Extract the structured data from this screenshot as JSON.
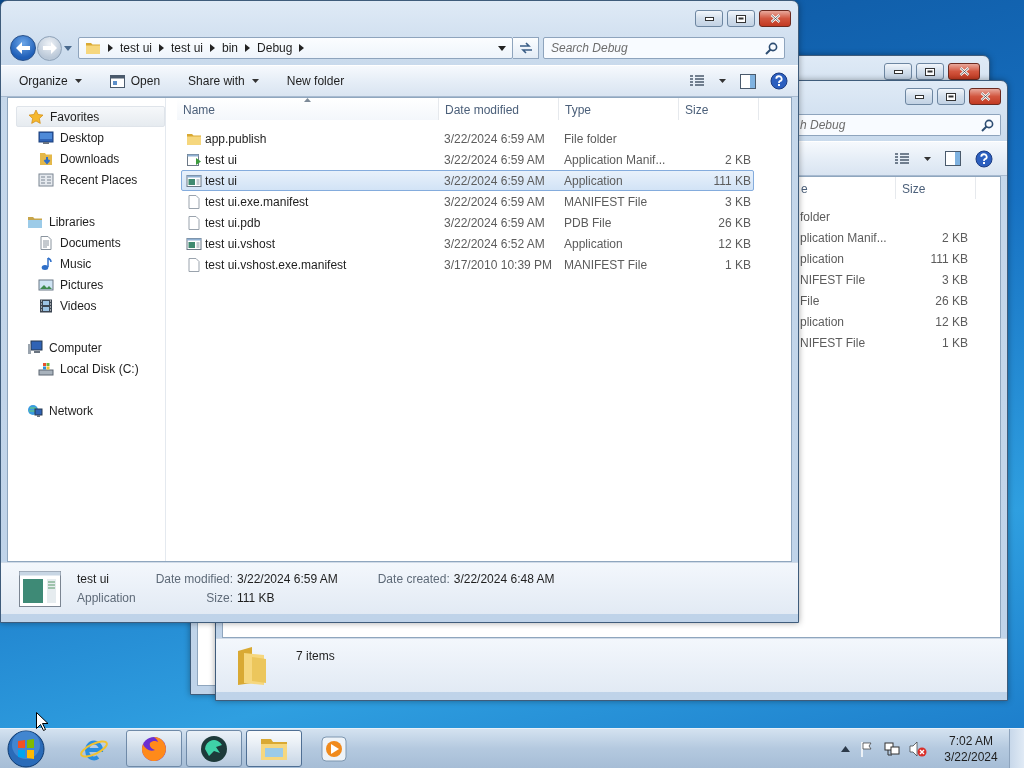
{
  "front_window": {
    "back_button": {
      "disabled": false
    },
    "forward_button": {
      "disabled": true
    },
    "breadcrumb": [
      "test ui",
      "test ui",
      "bin",
      "Debug"
    ],
    "search": {
      "placeholder": "Search Debug"
    },
    "toolbar": [
      {
        "label": "Organize",
        "kind": "menu"
      },
      {
        "label": "Open",
        "kind": "icon"
      },
      {
        "label": "Share with",
        "kind": "menu"
      },
      {
        "label": "New folder",
        "kind": "plain"
      }
    ],
    "nav_pane": [
      {
        "label": "Favorites",
        "kind": "star",
        "selected": true,
        "children": [
          {
            "label": "Desktop",
            "kind": "desktop",
            "selected": false
          },
          {
            "label": "Downloads",
            "kind": "downloads",
            "selected": false
          },
          {
            "label": "Recent Places",
            "kind": "recent",
            "selected": false
          }
        ]
      },
      {
        "label": "Libraries",
        "kind": "libraries",
        "selected": false,
        "children": [
          {
            "label": "Documents",
            "kind": "documents",
            "selected": false
          },
          {
            "label": "Music",
            "kind": "music",
            "selected": false
          },
          {
            "label": "Pictures",
            "kind": "pictures",
            "selected": false
          },
          {
            "label": "Videos",
            "kind": "videos",
            "selected": false
          }
        ]
      },
      {
        "label": "Computer",
        "kind": "computer",
        "selected": false,
        "children": [
          {
            "label": "Local Disk (C:)",
            "kind": "disk",
            "selected": false
          }
        ]
      },
      {
        "label": "Network",
        "kind": "network",
        "selected": false
      }
    ],
    "columns": [
      {
        "label": "Name",
        "sorted": true
      },
      {
        "label": "Date modified",
        "sorted": false
      },
      {
        "label": "Type",
        "sorted": false
      },
      {
        "label": "Size",
        "sorted": false
      }
    ],
    "rows": [
      {
        "kind": "folder",
        "name": "app.publish",
        "date": "3/22/2024 6:59 AM",
        "type": "File folder",
        "selected": false
      },
      {
        "kind": "manifest",
        "name": "test ui",
        "date": "3/22/2024 6:59 AM",
        "type": "Application Manif...",
        "size": "2 KB",
        "selected": false
      },
      {
        "kind": "app",
        "name": "test ui",
        "date": "3/22/2024 6:59 AM",
        "type": "Application",
        "size": "111 KB",
        "selected": true
      },
      {
        "kind": "file",
        "name": "test ui.exe.manifest",
        "date": "3/22/2024 6:59 AM",
        "type": "MANIFEST File",
        "size": "3 KB",
        "selected": false
      },
      {
        "kind": "file",
        "name": "test ui.pdb",
        "date": "3/22/2024 6:59 AM",
        "type": "PDB File",
        "size": "26 KB",
        "selected": false
      },
      {
        "kind": "app",
        "name": "test ui.vshost",
        "date": "3/22/2024 6:52 AM",
        "type": "Application",
        "size": "12 KB",
        "selected": false
      },
      {
        "kind": "file",
        "name": "test ui.vshost.exe.manifest",
        "date": "3/17/2010 10:39 PM",
        "type": "MANIFEST File",
        "size": "1 KB",
        "selected": false
      }
    ],
    "details": {
      "name": "test ui",
      "type": "Application",
      "fields": [
        {
          "label": "Date modified:",
          "value": "3/22/2024 6:59 AM"
        },
        {
          "label": "Date created:",
          "value": "3/22/2024 6:48 AM"
        },
        {
          "label": "Size:",
          "value": "111 KB"
        }
      ]
    }
  },
  "back_window": {
    "search": {
      "placeholder": "h Debug"
    },
    "columns": [
      {
        "label": "e"
      },
      {
        "label": "Size"
      }
    ],
    "rows": [
      {
        "type": "folder"
      },
      {
        "type": "plication Manif...",
        "size": "2 KB"
      },
      {
        "type": "plication",
        "size": "111 KB"
      },
      {
        "type": "NIFEST File",
        "size": "3 KB"
      },
      {
        "type": "File",
        "size": "26 KB"
      },
      {
        "type": "plication",
        "size": "12 KB"
      },
      {
        "type": "NIFEST File",
        "size": "1 KB"
      }
    ],
    "details": {
      "summary": "7 items"
    }
  },
  "taskbar": {
    "apps": [
      {
        "kind": "ie",
        "running": false,
        "active": false
      },
      {
        "kind": "firefox",
        "running": true,
        "active": false
      },
      {
        "kind": "green-app",
        "running": true,
        "active": false
      },
      {
        "kind": "explorer",
        "running": true,
        "active": true
      },
      {
        "kind": "media",
        "running": false,
        "active": false
      }
    ],
    "clock": {
      "time": "7:02 AM",
      "date": "3/22/2024"
    }
  }
}
